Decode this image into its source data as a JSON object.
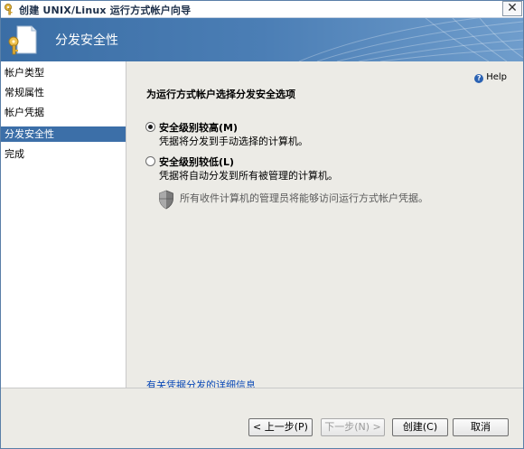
{
  "window": {
    "title": "创建 UNIX/Linux 运行方式帐户向导",
    "close_glyph": "✕"
  },
  "banner": {
    "title": "分发安全性"
  },
  "sidebar": {
    "items": [
      {
        "label": "帐户类型"
      },
      {
        "label": "常规属性"
      },
      {
        "label": "帐户凭据"
      },
      {
        "label": "分发安全性"
      },
      {
        "label": "完成"
      }
    ]
  },
  "content": {
    "help_label": "Help",
    "section_title": "为运行方式帐户选择分发安全选项",
    "options": [
      {
        "label": "安全级别较高(M)",
        "description": "凭据将分发到手动选择的计算机。",
        "checked": true
      },
      {
        "label": "安全级别较低(L)",
        "description": "凭据将自动分发到所有被管理的计算机。",
        "checked": false
      }
    ],
    "note": "所有收件计算机的管理员将能够访问运行方式帐户凭据。",
    "details_link": "有关凭据分发的详细信息"
  },
  "footer": {
    "back_label": "< 上一步(P)",
    "next_label": "下一步(N) >",
    "create_label": "创建(C)",
    "cancel_label": "取消"
  },
  "colors": {
    "banner": "#4b7eb5",
    "selected_nav": "#3c6fa8",
    "content_bg": "#ecebe6",
    "link": "#0a49b6"
  }
}
